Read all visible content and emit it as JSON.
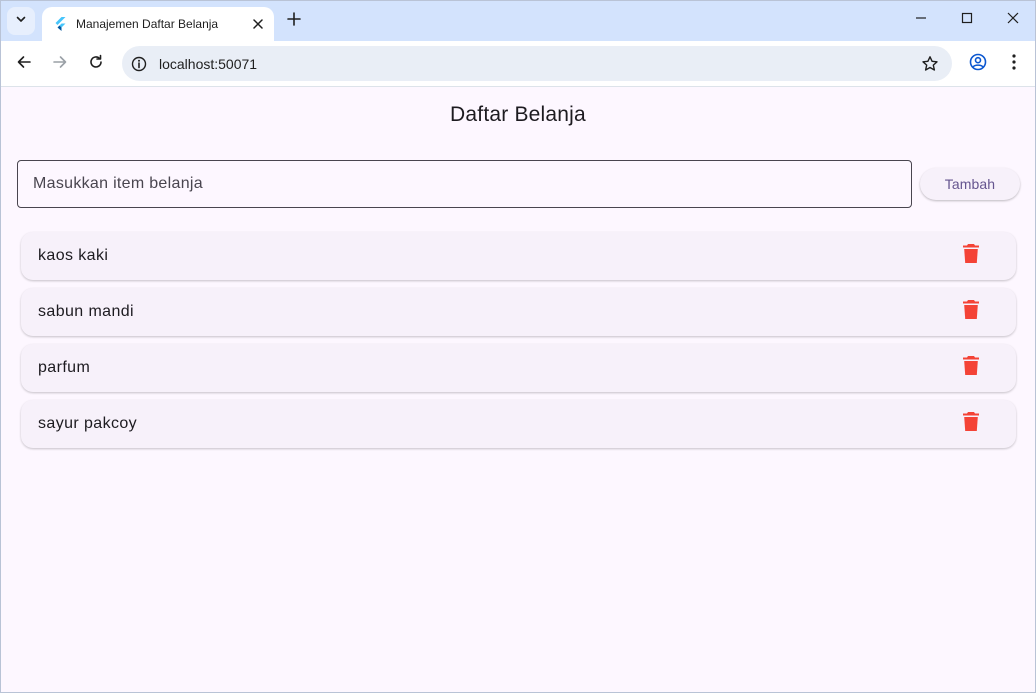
{
  "browser": {
    "tab_title": "Manajemen Daftar Belanja",
    "url": "localhost:50071"
  },
  "app": {
    "title": "Daftar Belanja",
    "input_placeholder": "Masukkan item belanja",
    "input_value": "",
    "add_button_label": "Tambah",
    "items": [
      {
        "label": "kaos kaki"
      },
      {
        "label": "sabun mandi"
      },
      {
        "label": "parfum"
      },
      {
        "label": "sayur pakcoy"
      }
    ]
  },
  "colors": {
    "delete_icon": "#f44336",
    "background": "#fdf7ff",
    "button_text": "#65558f",
    "tab_strip": "#d3e3fd"
  },
  "icons": {
    "tab_search": "chevron-down-icon",
    "favicon": "flutter-icon",
    "tab_close": "close-icon",
    "new_tab": "plus-icon",
    "back": "arrow-left-icon",
    "forward": "arrow-right-icon",
    "reload": "reload-icon",
    "site_info": "site-info-icon",
    "bookmark": "star-icon",
    "profile": "profile-icon",
    "menu": "more-vert-icon",
    "delete": "trash-icon"
  }
}
